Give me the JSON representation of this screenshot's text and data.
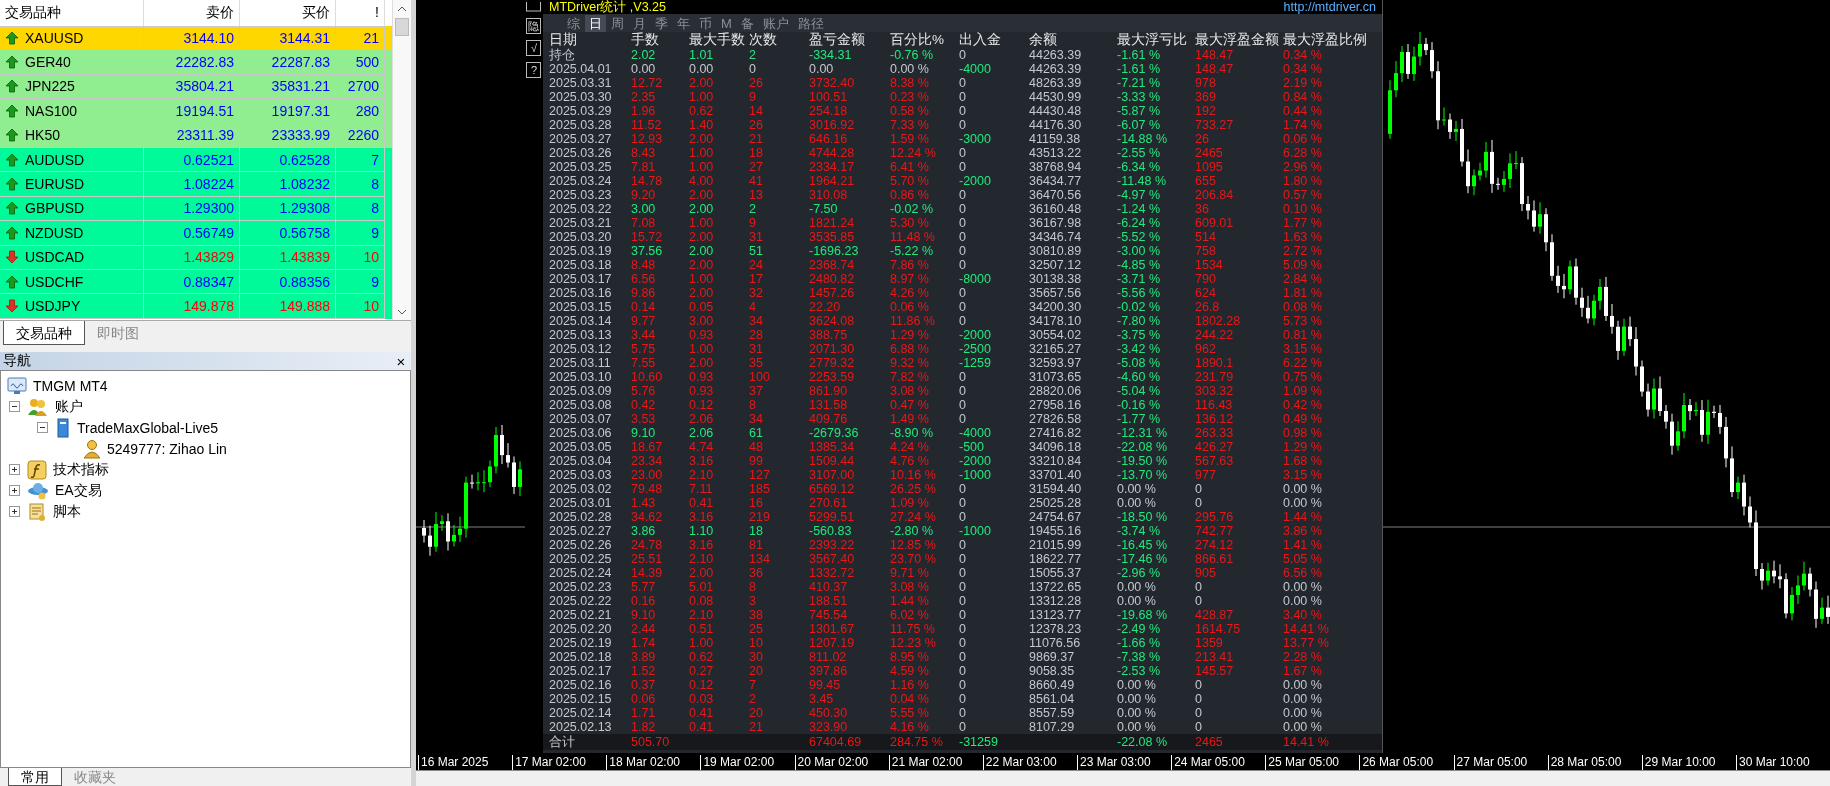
{
  "market_watch": {
    "columns": [
      "交易品种",
      "卖价",
      "买价",
      "!"
    ],
    "rows": [
      {
        "symbol": "XAUUSD",
        "bid": "3144.10",
        "ask": "3144.31",
        "spread": "21",
        "rising": true,
        "color": "#ffd700"
      },
      {
        "symbol": "GER40",
        "bid": "22282.83",
        "ask": "22287.83",
        "spread": "500",
        "rising": true,
        "color": "#90ee90"
      },
      {
        "symbol": "JPN225",
        "bid": "35804.21",
        "ask": "35831.21",
        "spread": "2700",
        "rising": true,
        "color": "#90ee90"
      },
      {
        "symbol": "NAS100",
        "bid": "19194.51",
        "ask": "19197.31",
        "spread": "280",
        "rising": true,
        "color": "#90ee90"
      },
      {
        "symbol": "HK50",
        "bid": "23311.39",
        "ask": "23333.99",
        "spread": "2260",
        "rising": true,
        "color": "#90ee90"
      },
      {
        "symbol": "AUDUSD",
        "bid": "0.62521",
        "ask": "0.62528",
        "spread": "7",
        "rising": true,
        "color": "#00fa9a"
      },
      {
        "symbol": "EURUSD",
        "bid": "1.08224",
        "ask": "1.08232",
        "spread": "8",
        "rising": true,
        "color": "#00fa9a"
      },
      {
        "symbol": "GBPUSD",
        "bid": "1.29300",
        "ask": "1.29308",
        "spread": "8",
        "rising": true,
        "color": "#00fa9a"
      },
      {
        "symbol": "NZDUSD",
        "bid": "0.56749",
        "ask": "0.56758",
        "spread": "9",
        "rising": true,
        "color": "#00fa9a"
      },
      {
        "symbol": "USDCAD",
        "bid": "1.43829",
        "ask": "1.43839",
        "spread": "10",
        "rising": false,
        "color": "#00fa9a"
      },
      {
        "symbol": "USDCHF",
        "bid": "0.88347",
        "ask": "0.88356",
        "spread": "9",
        "rising": true,
        "color": "#00fa9a"
      },
      {
        "symbol": "USDJPY",
        "bid": "149.878",
        "ask": "149.888",
        "spread": "10",
        "rising": false,
        "color": "#00fa9a"
      }
    ],
    "tabs": [
      {
        "label": "交易品种",
        "selected": true
      },
      {
        "label": "即时图",
        "selected": false
      }
    ]
  },
  "navigator": {
    "title": "导航",
    "close": "×",
    "tree": {
      "label": "TMGM MT4",
      "kind": "terminal",
      "children": [
        {
          "label": "账户",
          "kind": "accounts",
          "expanded": true,
          "children": [
            {
              "label": "TradeMaxGlobal-Live5",
              "kind": "server",
              "expanded": true,
              "children": [
                {
                  "label": "5249777: Zihao Lin",
                  "kind": "account"
                }
              ]
            }
          ]
        },
        {
          "label": "技术指标",
          "kind": "indicators",
          "expanded": false
        },
        {
          "label": "EA交易",
          "kind": "experts",
          "expanded": false
        },
        {
          "label": "脚本",
          "kind": "scripts",
          "expanded": false
        }
      ]
    },
    "tabs": [
      {
        "label": "常用",
        "selected": true
      },
      {
        "label": "收藏夹",
        "selected": false
      }
    ]
  },
  "chart": {
    "time_labels": [
      "16 Mar 2025",
      "17 Mar 02:00",
      "18 Mar 02:00",
      "19 Mar 02:00",
      "20 Mar 02:00",
      "21 Mar 02:00",
      "22 Mar 03:00",
      "23 Mar 03:00",
      "24 Mar 05:00",
      "25 Mar 05:00",
      "26 Mar 05:00",
      "27 Mar 05:00",
      "28 Mar 05:00",
      "29 Mar 10:00",
      "30 Mar 10:00"
    ]
  },
  "stats_panel": {
    "title": "MTDriver统计 ,V3.25",
    "link": "http://mtdriver.cn",
    "side_buttons": [
      "隐",
      "√",
      "?"
    ],
    "tabs": [
      {
        "label": "综",
        "selected": false
      },
      {
        "label": "日",
        "selected": true
      },
      {
        "label": "周",
        "selected": false
      },
      {
        "label": "月",
        "selected": false
      },
      {
        "label": "季",
        "selected": false
      },
      {
        "label": "年",
        "selected": false
      },
      {
        "label": "币",
        "selected": false
      },
      {
        "label": "M",
        "selected": false
      },
      {
        "label": "备",
        "selected": false
      },
      {
        "label": "账户",
        "selected": false
      },
      {
        "label": "路径",
        "selected": false
      }
    ],
    "columns": [
      "日期",
      "手数",
      "最大手数",
      "次数",
      "盈亏金额",
      "百分比%",
      "出入金",
      "余额",
      "最大浮亏比",
      "最大浮盈金额",
      "最大浮盈比例"
    ],
    "rows": [
      {
        "kind": "loss",
        "cells": [
          "持仓",
          "2.02",
          "1.01",
          "2",
          "-334.31",
          "-0.76 %",
          "0",
          "44263.39",
          "-1.61 %",
          "148.47",
          "0.34 %"
        ]
      },
      {
        "kind": "flat",
        "cells": [
          "2025.04.01",
          "0.00",
          "0.00",
          "0",
          "0.00",
          "0.00 %",
          "-4000",
          "44263.39",
          "-1.61 %",
          "148.47",
          "0.34 %"
        ]
      },
      {
        "kind": "profit",
        "cells": [
          "2025.03.31",
          "12.72",
          "2.00",
          "26",
          "3732.40",
          "8.38 %",
          "0",
          "48263.39",
          "-7.21 %",
          "978",
          "2.19 %"
        ]
      },
      {
        "kind": "profit",
        "cells": [
          "2025.03.30",
          "2.35",
          "1.00",
          "9",
          "100.51",
          "0.23 %",
          "0",
          "44530.99",
          "-3.33 %",
          "369",
          "0.84 %"
        ]
      },
      {
        "kind": "profit",
        "cells": [
          "2025.03.29",
          "1.96",
          "0.62",
          "14",
          "254.18",
          "0.58 %",
          "0",
          "44430.48",
          "-5.87 %",
          "192",
          "0.44 %"
        ]
      },
      {
        "kind": "profit",
        "cells": [
          "2025.03.28",
          "11.52",
          "1.40",
          "26",
          "3016.92",
          "7.33 %",
          "0",
          "44176.30",
          "-6.07 %",
          "733.27",
          "1.74 %"
        ]
      },
      {
        "kind": "profit",
        "cells": [
          "2025.03.27",
          "12.93",
          "2.00",
          "21",
          "646.16",
          "1.59 %",
          "-3000",
          "41159.38",
          "-14.88 %",
          "26",
          "0.06 %"
        ]
      },
      {
        "kind": "profit",
        "cells": [
          "2025.03.26",
          "8.43",
          "1.00",
          "18",
          "4744.28",
          "12.24 %",
          "0",
          "43513.22",
          "-2.55 %",
          "2465",
          "6.28 %"
        ]
      },
      {
        "kind": "profit",
        "cells": [
          "2025.03.25",
          "7.81",
          "1.00",
          "27",
          "2334.17",
          "6.41 %",
          "0",
          "38768.94",
          "-6.34 %",
          "1095",
          "2.96 %"
        ]
      },
      {
        "kind": "profit",
        "cells": [
          "2025.03.24",
          "14.78",
          "4.00",
          "41",
          "1964.21",
          "5.70 %",
          "-2000",
          "36434.77",
          "-11.48 %",
          "655",
          "1.80 %"
        ]
      },
      {
        "kind": "profit",
        "cells": [
          "2025.03.23",
          "9.20",
          "2.00",
          "13",
          "310.08",
          "0.86 %",
          "0",
          "36470.56",
          "-4.97 %",
          "206.84",
          "0.57 %"
        ]
      },
      {
        "kind": "loss",
        "cells": [
          "2025.03.22",
          "3.00",
          "2.00",
          "2",
          "-7.50",
          "-0.02 %",
          "0",
          "36160.48",
          "-1.24 %",
          "36",
          "0.10 %"
        ]
      },
      {
        "kind": "profit",
        "cells": [
          "2025.03.21",
          "7.08",
          "1.00",
          "9",
          "1821.24",
          "5.30 %",
          "0",
          "36167.98",
          "-6.24 %",
          "609.01",
          "1.77 %"
        ]
      },
      {
        "kind": "profit",
        "cells": [
          "2025.03.20",
          "15.72",
          "2.00",
          "31",
          "3535.85",
          "11.48 %",
          "0",
          "34346.74",
          "-5.52 %",
          "514",
          "1.63 %"
        ]
      },
      {
        "kind": "loss",
        "cells": [
          "2025.03.19",
          "37.56",
          "2.00",
          "51",
          "-1696.23",
          "-5.22 %",
          "0",
          "30810.89",
          "-3.00 %",
          "758",
          "2.72 %"
        ]
      },
      {
        "kind": "profit",
        "cells": [
          "2025.03.18",
          "8.48",
          "2.00",
          "24",
          "2368.74",
          "7.86 %",
          "0",
          "32507.12",
          "-4.85 %",
          "1534",
          "5.09 %"
        ]
      },
      {
        "kind": "profit",
        "cells": [
          "2025.03.17",
          "6.56",
          "1.00",
          "17",
          "2480.82",
          "8.97 %",
          "-8000",
          "30138.38",
          "-3.71 %",
          "790",
          "2.84 %"
        ]
      },
      {
        "kind": "profit",
        "cells": [
          "2025.03.16",
          "9.86",
          "2.00",
          "32",
          "1457.26",
          "4.26 %",
          "0",
          "35657.56",
          "-5.56 %",
          "624",
          "1.81 %"
        ]
      },
      {
        "kind": "profit",
        "cells": [
          "2025.03.15",
          "0.14",
          "0.05",
          "4",
          "22.20",
          "0.06 %",
          "0",
          "34200.30",
          "-0.02 %",
          "26.8",
          "0.08 %"
        ]
      },
      {
        "kind": "profit",
        "cells": [
          "2025.03.14",
          "9.77",
          "3.00",
          "34",
          "3624.08",
          "11.86 %",
          "0",
          "34178.10",
          "-7.80 %",
          "1802.28",
          "5.73 %"
        ]
      },
      {
        "kind": "profit",
        "cells": [
          "2025.03.13",
          "3.44",
          "0.93",
          "28",
          "388.75",
          "1.29 %",
          "-2000",
          "30554.02",
          "-3.75 %",
          "244.22",
          "0.81 %"
        ]
      },
      {
        "kind": "profit",
        "cells": [
          "2025.03.12",
          "5.75",
          "1.00",
          "31",
          "2071.30",
          "6.88 %",
          "-2500",
          "32165.27",
          "-3.42 %",
          "962",
          "3.15 %"
        ]
      },
      {
        "kind": "profit",
        "cells": [
          "2025.03.11",
          "7.55",
          "2.00",
          "35",
          "2779.32",
          "9.32 %",
          "-1259",
          "32593.97",
          "-5.08 %",
          "1890.1",
          "6.22 %"
        ]
      },
      {
        "kind": "profit",
        "cells": [
          "2025.03.10",
          "10.60",
          "0.93",
          "100",
          "2253.59",
          "7.82 %",
          "0",
          "31073.65",
          "-4.60 %",
          "231.79",
          "0.75 %"
        ]
      },
      {
        "kind": "profit",
        "cells": [
          "2025.03.09",
          "5.76",
          "0.93",
          "37",
          "861.90",
          "3.08 %",
          "0",
          "28820.06",
          "-5.04 %",
          "303.32",
          "1.09 %"
        ]
      },
      {
        "kind": "profit",
        "cells": [
          "2025.03.08",
          "0.42",
          "0.12",
          "8",
          "131.58",
          "0.47 %",
          "0",
          "27958.16",
          "-0.16 %",
          "116.43",
          "0.42 %"
        ]
      },
      {
        "kind": "profit",
        "cells": [
          "2025.03.07",
          "3.53",
          "2.06",
          "34",
          "409.76",
          "1.49 %",
          "0",
          "27826.58",
          "-1.77 %",
          "136.12",
          "0.49 %"
        ]
      },
      {
        "kind": "loss",
        "cells": [
          "2025.03.06",
          "9.10",
          "2.06",
          "61",
          "-2679.36",
          "-8.90 %",
          "-4000",
          "27416.82",
          "-12.31 %",
          "263.33",
          "0.98 %"
        ]
      },
      {
        "kind": "profit",
        "cells": [
          "2025.03.05",
          "18.67",
          "4.74",
          "48",
          "1385.34",
          "4.24 %",
          "-500",
          "34096.18",
          "-22.08 %",
          "426.27",
          "1.29 %"
        ]
      },
      {
        "kind": "profit",
        "cells": [
          "2025.03.04",
          "23.34",
          "3.16",
          "99",
          "1509.44",
          "4.76 %",
          "-2000",
          "33210.84",
          "-19.50 %",
          "567.63",
          "1.68 %"
        ]
      },
      {
        "kind": "profit",
        "cells": [
          "2025.03.03",
          "23.00",
          "2.10",
          "127",
          "3107.00",
          "10.16 %",
          "-1000",
          "33701.40",
          "-13.70 %",
          "977",
          "3.15 %"
        ]
      },
      {
        "kind": "profit",
        "cells": [
          "2025.03.02",
          "79.48",
          "7.11",
          "185",
          "6569.12",
          "26.25 %",
          "0",
          "31594.40",
          "0.00 %",
          "0",
          "0.00 %"
        ]
      },
      {
        "kind": "profit",
        "cells": [
          "2025.03.01",
          "1.43",
          "0.41",
          "16",
          "270.61",
          "1.09 %",
          "0",
          "25025.28",
          "0.00 %",
          "0",
          "0.00 %"
        ]
      },
      {
        "kind": "profit",
        "cells": [
          "2025.02.28",
          "34.62",
          "3.16",
          "219",
          "5299.51",
          "27.24 %",
          "0",
          "24754.67",
          "-18.50 %",
          "295.76",
          "1.44 %"
        ]
      },
      {
        "kind": "loss",
        "cells": [
          "2025.02.27",
          "3.86",
          "1.10",
          "18",
          "-560.83",
          "-2.80 %",
          "-1000",
          "19455.16",
          "-3.74 %",
          "742.77",
          "3.86 %"
        ]
      },
      {
        "kind": "profit",
        "cells": [
          "2025.02.26",
          "24.78",
          "3.16",
          "81",
          "2393.22",
          "12.85 %",
          "0",
          "21015.99",
          "-16.45 %",
          "274.12",
          "1.41 %"
        ]
      },
      {
        "kind": "profit",
        "cells": [
          "2025.02.25",
          "25.51",
          "2.10",
          "134",
          "3567.40",
          "23.70 %",
          "0",
          "18622.77",
          "-17.46 %",
          "866.61",
          "5.05 %"
        ]
      },
      {
        "kind": "profit",
        "cells": [
          "2025.02.24",
          "14.39",
          "2.00",
          "36",
          "1332.72",
          "9.71 %",
          "0",
          "15055.37",
          "-2.96 %",
          "905",
          "6.56 %"
        ]
      },
      {
        "kind": "profit",
        "cells": [
          "2025.02.23",
          "5.77",
          "5.01",
          "8",
          "410.37",
          "3.08 %",
          "0",
          "13722.65",
          "0.00 %",
          "0",
          "0.00 %"
        ]
      },
      {
        "kind": "profit",
        "cells": [
          "2025.02.22",
          "0.16",
          "0.08",
          "3",
          "188.51",
          "1.44 %",
          "0",
          "13312.28",
          "0.00 %",
          "0",
          "0.00 %"
        ]
      },
      {
        "kind": "profit",
        "cells": [
          "2025.02.21",
          "9.10",
          "2.10",
          "38",
          "745.54",
          "6.02 %",
          "0",
          "13123.77",
          "-19.68 %",
          "428.87",
          "3.40 %"
        ]
      },
      {
        "kind": "profit",
        "cells": [
          "2025.02.20",
          "2.44",
          "0.51",
          "25",
          "1301.67",
          "11.75 %",
          "0",
          "12378.23",
          "-2.49 %",
          "1614.75",
          "14.41 %"
        ]
      },
      {
        "kind": "profit",
        "cells": [
          "2025.02.19",
          "1.74",
          "1.00",
          "10",
          "1207.19",
          "12.23 %",
          "0",
          "11076.56",
          "-1.66 %",
          "1359",
          "13.77 %"
        ]
      },
      {
        "kind": "profit",
        "cells": [
          "2025.02.18",
          "3.89",
          "0.62",
          "30",
          "811.02",
          "8.95 %",
          "0",
          "9869.37",
          "-7.38 %",
          "213.41",
          "2.28 %"
        ]
      },
      {
        "kind": "profit",
        "cells": [
          "2025.02.17",
          "1.52",
          "0.27",
          "20",
          "397.86",
          "4.59 %",
          "0",
          "9058.35",
          "-2.53 %",
          "145.57",
          "1.67 %"
        ]
      },
      {
        "kind": "profit",
        "cells": [
          "2025.02.16",
          "0.37",
          "0.12",
          "7",
          "99.45",
          "1.16 %",
          "0",
          "8660.49",
          "0.00 %",
          "0",
          "0.00 %"
        ]
      },
      {
        "kind": "profit",
        "cells": [
          "2025.02.15",
          "0.06",
          "0.03",
          "2",
          "3.45",
          "0.04 %",
          "0",
          "8561.04",
          "0.00 %",
          "0",
          "0.00 %"
        ]
      },
      {
        "kind": "profit",
        "cells": [
          "2025.02.14",
          "1.71",
          "0.41",
          "20",
          "450.30",
          "5.55 %",
          "0",
          "8557.59",
          "0.00 %",
          "0",
          "0.00 %"
        ]
      },
      {
        "kind": "profit",
        "cells": [
          "2025.02.13",
          "1.82",
          "0.41",
          "21",
          "323.90",
          "4.16 %",
          "0",
          "8107.29",
          "0.00 %",
          "0",
          "0.00 %"
        ]
      }
    ],
    "total": {
      "label": "合计",
      "kind": "profit",
      "lots": "505.70",
      "pnl": "67404.69",
      "percent": "284.75 %",
      "transfer": "-31259",
      "max_float_loss": "-22.08 %",
      "max_float_profit_amount": "2465",
      "max_float_profit_pct": "14.41 %"
    }
  }
}
